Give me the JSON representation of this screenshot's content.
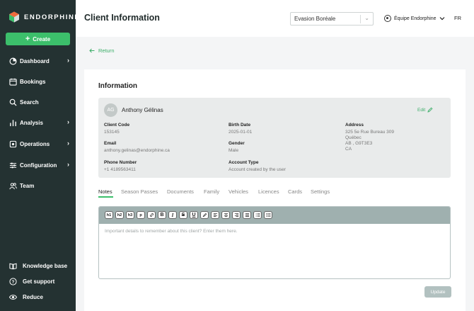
{
  "app": {
    "brand": "ENDORPHINE",
    "colors": {
      "sidebar": "#243232",
      "accent": "#3cbf6b",
      "link": "#3cae69"
    }
  },
  "sidebar": {
    "create_label": "Create",
    "items": [
      {
        "label": "Dashboard",
        "icon": "dashboard-icon",
        "has_children": true
      },
      {
        "label": "Bookings",
        "icon": "calendar-icon",
        "has_children": false
      },
      {
        "label": "Search",
        "icon": "search-icon",
        "has_children": false
      },
      {
        "label": "Analysis",
        "icon": "bar-chart-icon",
        "has_children": true
      },
      {
        "label": "Operations",
        "icon": "operations-icon",
        "has_children": true
      },
      {
        "label": "Configuration",
        "icon": "sliders-icon",
        "has_children": true
      },
      {
        "label": "Team",
        "icon": "team-icon",
        "has_children": false
      }
    ],
    "bottom_items": [
      {
        "label": "Knowledge base",
        "icon": "book-icon"
      },
      {
        "label": "Get support",
        "icon": "help-icon"
      },
      {
        "label": "Reduce",
        "icon": "eye-icon"
      }
    ]
  },
  "header": {
    "title": "Client Information",
    "client_select": "Evasion Boréale",
    "team": "Équipe Endorphine",
    "language": "FR"
  },
  "back_label": "Return",
  "info": {
    "section_title": "Information",
    "avatar_initials": "AG",
    "client_name": "Anthony Gélinas",
    "edit_label": "Edit",
    "fields": {
      "client_code": {
        "label": "Client Code",
        "value": "153145"
      },
      "email": {
        "label": "Email",
        "value": "anthony.gelinas@endorphine.ca"
      },
      "phone": {
        "label": "Phone Number",
        "value": "+1 4189563411"
      },
      "birth_date": {
        "label": "Birth Date",
        "value": "2025-01-01"
      },
      "gender": {
        "label": "Gender",
        "value": "Male"
      },
      "account_type": {
        "label": "Account Type",
        "value": "Account created by the user"
      },
      "address": {
        "label": "Address",
        "line1": "325 5e Rue Bureau 309",
        "line2": "Québec",
        "line3": "AB , G9T3E3",
        "line4": "CA"
      }
    }
  },
  "tabs": [
    "Notes",
    "Season Passes",
    "Documents",
    "Family",
    "Vehicles",
    "Licences",
    "Cards",
    "Settings"
  ],
  "active_tab": "Notes",
  "editor": {
    "toolbar": [
      "h1",
      "h2",
      "h3",
      "p",
      "link",
      "B",
      "I",
      "S",
      "U",
      "highlight",
      "align-left",
      "align-center",
      "align-right",
      "justify",
      "ordered-list",
      "bullet-list"
    ],
    "placeholder": "Important details to remember about this client? Enter them here."
  },
  "update_label": "Update"
}
